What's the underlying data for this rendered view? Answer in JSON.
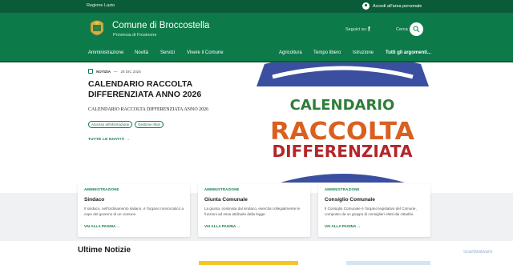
{
  "topbar": {
    "region": "Regione Lazio",
    "login": "Accedi all'area personale"
  },
  "header": {
    "title": "Comune di Broccostella",
    "subtitle": "Provincia di Frosinone",
    "social_label": "Seguici su:",
    "search_label": "Cerca"
  },
  "nav": {
    "left": [
      "Amministrazione",
      "Novità",
      "Servizi",
      "Vivere il Comune"
    ],
    "right": [
      "Agricoltura",
      "Tempo libero",
      "Istruzione"
    ],
    "all_topics": "Tutti gli argomenti..."
  },
  "hero": {
    "tag": "NOTIZIA",
    "date": "28 DIC 2025",
    "title": "CALENDARIO RACCOLTA DIFFERENZIATA ANNO 2026",
    "description": "CALENDARIO RACCOLTA DIFFERENZIATA ANNO 2026",
    "chips": [
      "Accesso all'informazione",
      "Gestione rifiuti"
    ],
    "all_news": "TUTTE LE NOVITÀ",
    "image_text": [
      "CALENDARIO",
      "RACCOLTA",
      "DIFFERENZIATA"
    ]
  },
  "cards": [
    {
      "category": "AMMINISTRAZIONE",
      "title": "Sindaco",
      "description": "Il sindaco, nell'ordinamento italiano, è l'organo monocratico a capo del governo di un comune.",
      "link": "VAI ALLA PAGINA"
    },
    {
      "category": "AMMINISTRAZIONE",
      "title": "Giunta Comunale",
      "description": "La giunta, nominata dal sindaco, esercita collegialmente le funzioni ad essa attribuite dalla legge.",
      "link": "VAI ALLA PAGINA"
    },
    {
      "category": "AMMINISTRAZIONE",
      "title": "Consiglio Comunale",
      "description": "Il Consiglio Comunale è l'organo legislativo del Comune, composto da un gruppo di consiglieri eletti dai cittadini.",
      "link": "VAI ALLA PAGINA"
    }
  ],
  "latest_news": {
    "heading": "Ultime Notizie"
  },
  "watermark": "ScanMalware",
  "colors": {
    "brand_green": "#0d7a4a",
    "dark_green": "#0a5c38",
    "image_blue": "#3b4fa0",
    "image_orange": "#d9601f",
    "image_red": "#b3262b"
  }
}
